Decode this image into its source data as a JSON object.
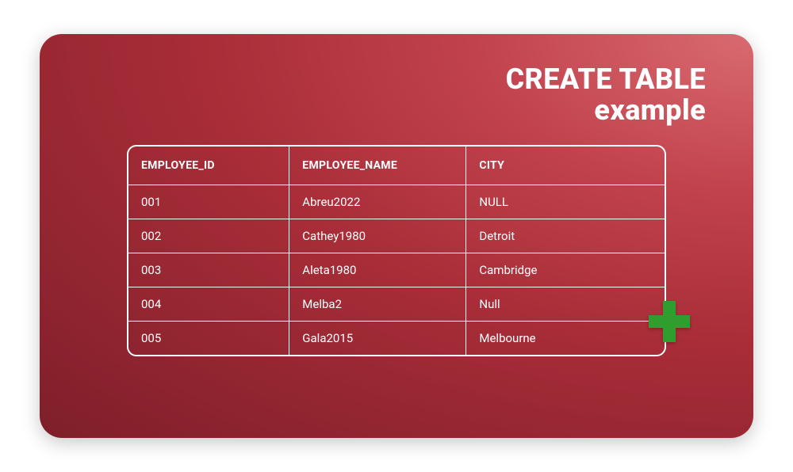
{
  "title": {
    "line1": "CREATE TABLE",
    "line2": "example"
  },
  "table": {
    "headers": [
      "EMPLOYEE_ID",
      "EMPLOYEE_NAME",
      "CITY"
    ],
    "rows": [
      {
        "id": "001",
        "name": "Abreu2022",
        "city": "NULL"
      },
      {
        "id": "002",
        "name": "Cathey1980",
        "city": "Detroit"
      },
      {
        "id": "003",
        "name": "Aleta1980",
        "city": "Cambridge"
      },
      {
        "id": "004",
        "name": "Melba2",
        "city": "Null"
      },
      {
        "id": "005",
        "name": "Gala2015",
        "city": "Melbourne"
      }
    ]
  },
  "colors": {
    "accent_green": "#2f9e2f"
  }
}
